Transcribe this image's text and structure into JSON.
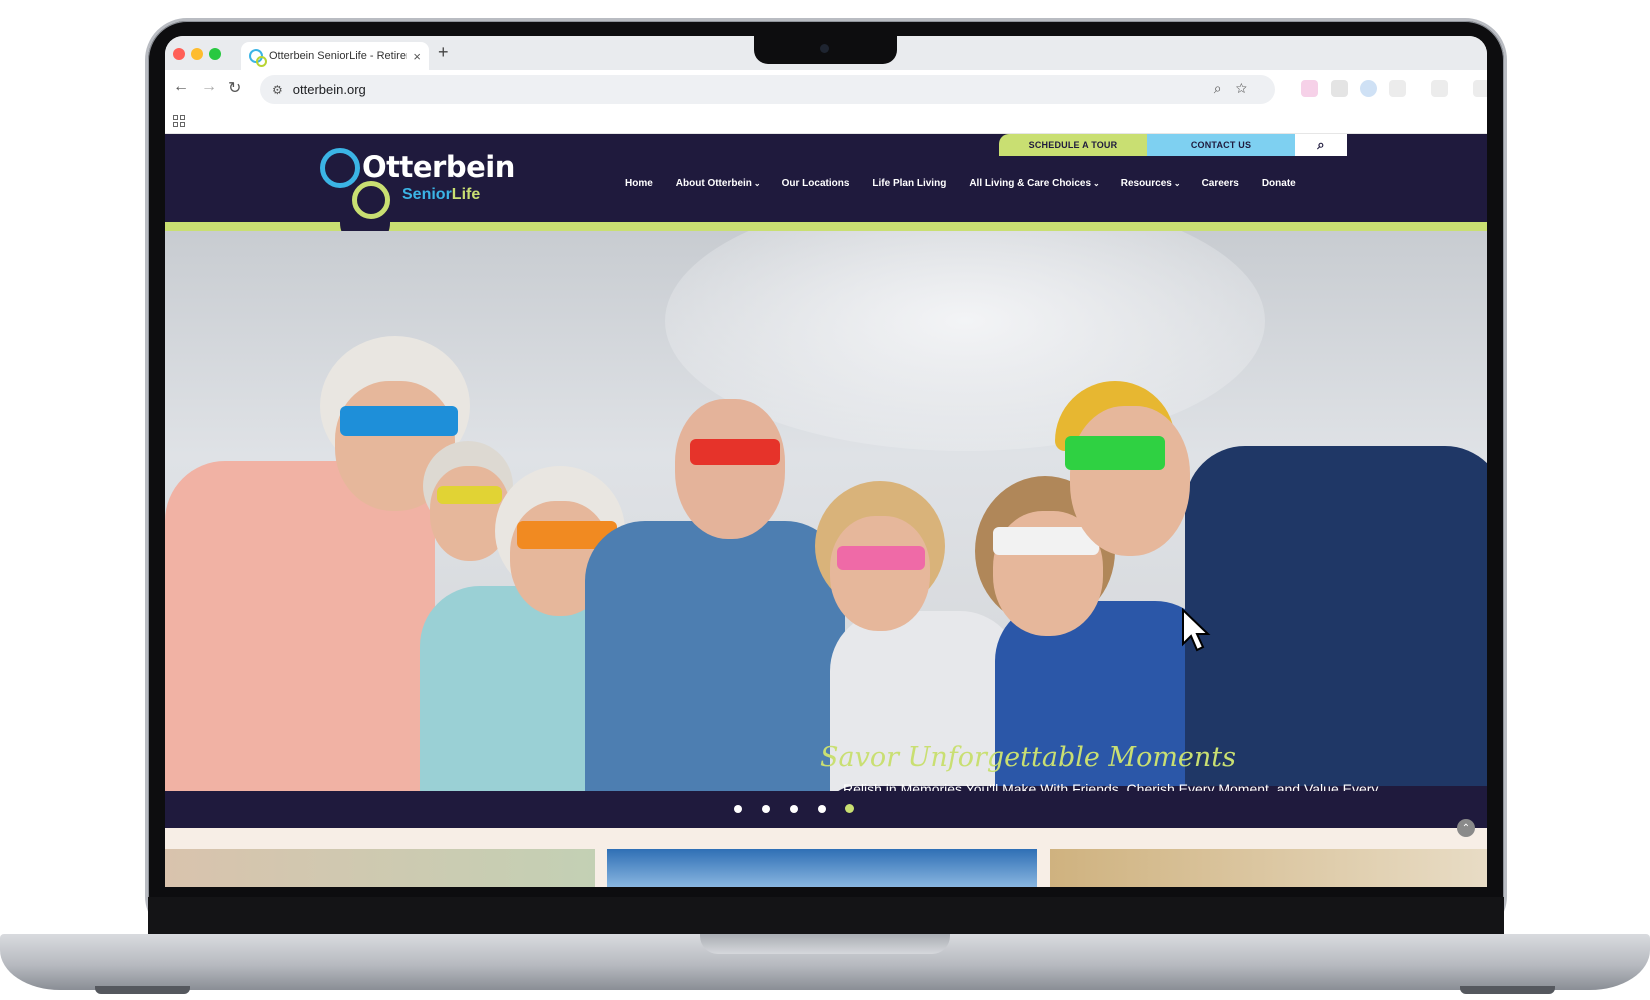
{
  "browser": {
    "tab_title": "Otterbein SeniorLife - Retirem",
    "tab_close": "×",
    "new_tab": "+",
    "url": "otterbein.org",
    "back": "←",
    "forward": "→",
    "reload": "↻",
    "site_info": "⚙",
    "omnibox_actions": "⌕☆"
  },
  "site": {
    "logo_word": "Otterbein",
    "logo_sub_a": "Senior",
    "logo_sub_b": "Life",
    "util": {
      "tour": "SCHEDULE A TOUR",
      "contact": "CONTACT US",
      "search_icon": "⌕"
    },
    "nav": [
      {
        "label": "Home",
        "caret": ""
      },
      {
        "label": "About Otterbein",
        "caret": "⌄"
      },
      {
        "label": "Our Locations",
        "caret": ""
      },
      {
        "label": "Life Plan Living",
        "caret": ""
      },
      {
        "label": "All Living & Care Choices",
        "caret": "⌄"
      },
      {
        "label": "Resources",
        "caret": "⌄"
      },
      {
        "label": "Careers",
        "caret": ""
      },
      {
        "label": "Donate",
        "caret": ""
      }
    ],
    "hero": {
      "title": "Savor Unforgettable Moments",
      "text": "Relish in Memories You'll Make With Friends, Cherish Every Moment, and Value Every Connection."
    },
    "slider": {
      "count": 5,
      "active_index": 4
    },
    "scroll_top_icon": "⌃"
  },
  "colors": {
    "navy": "#1f1a3d",
    "lime": "#c9df72",
    "sky": "#7ed0f1",
    "brand_blue": "#3bb4e5"
  }
}
